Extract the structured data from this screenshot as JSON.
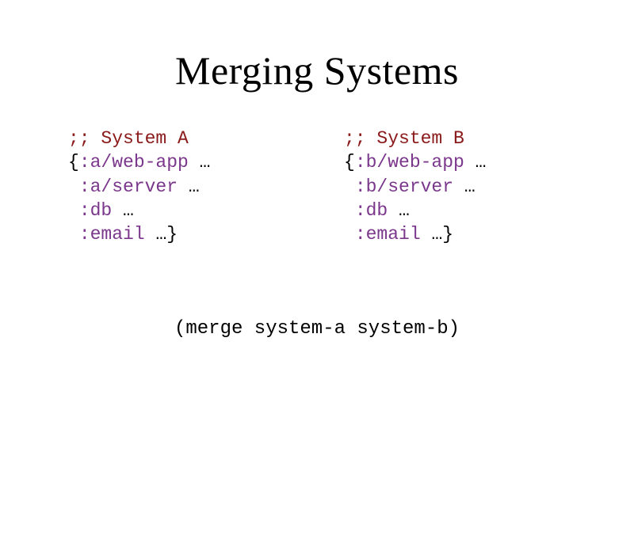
{
  "title": "Merging Systems",
  "systemA": {
    "comment": ";; System A",
    "line1_open": "{",
    "line1_kw": ":a/web-app",
    "line1_rest": " …",
    "line2_kw": ":a/server",
    "line2_rest": " …",
    "line3_kw": ":db",
    "line3_rest": " …",
    "line4_kw": ":email",
    "line4_rest": " …",
    "line4_close": "}"
  },
  "systemB": {
    "comment": ";; System B",
    "line1_open": "{",
    "line1_kw": ":b/web-app",
    "line1_rest": " …",
    "line2_kw": ":b/server",
    "line2_rest": " …",
    "line3_kw": ":db",
    "line3_rest": " …",
    "line4_kw": ":email",
    "line4_rest": " …",
    "line4_close": "}"
  },
  "mergeExpr": "(merge system-a system-b)"
}
